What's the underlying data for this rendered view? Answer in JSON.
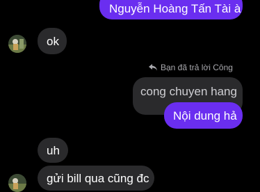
{
  "colors": {
    "background": "#000000",
    "outgoing_bubble": "#6a2ef0",
    "incoming_bubble": "#2a2a2c",
    "meta_text": "#a8a8ad"
  },
  "messages": {
    "out_name": "Nguyễn Hoàng Tấn Tài à",
    "in_ok": "ok",
    "reply_label": "Bạn đã trả lời Công",
    "quoted_text": "cong chuyen hang",
    "out_content": "Nội dung hả",
    "in_uh": "uh",
    "in_bill": "gửi bill qua cũng đc"
  },
  "icons": {
    "reply_icon": "reply-arrow-icon",
    "avatar": "contact-avatar"
  }
}
